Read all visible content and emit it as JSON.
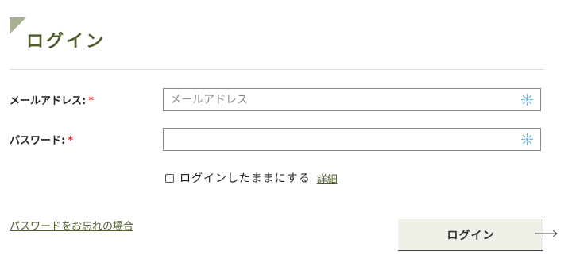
{
  "header": {
    "title": "ログイン"
  },
  "form": {
    "email": {
      "label": "メールアドレス:",
      "required_mark": "*",
      "placeholder": "メールアドレス",
      "value": ""
    },
    "password": {
      "label": "パスワード:",
      "required_mark": "*",
      "placeholder": "",
      "value": ""
    },
    "remember": {
      "label": "ログインしたままにする",
      "checked": false,
      "details_link": "詳細"
    },
    "forgot_link": "パスワードをお忘れの場合",
    "submit_label": "ログイン"
  },
  "icons": {
    "field_icon": "keyboard-helper-icon",
    "submit_icon": "arrow-right-icon"
  },
  "colors": {
    "accent": "#4e5f2b",
    "corner": "#a7b093",
    "required": "#d23a3a",
    "button_bg": "#eff0e8",
    "field_icon": "#6fb6e6"
  }
}
